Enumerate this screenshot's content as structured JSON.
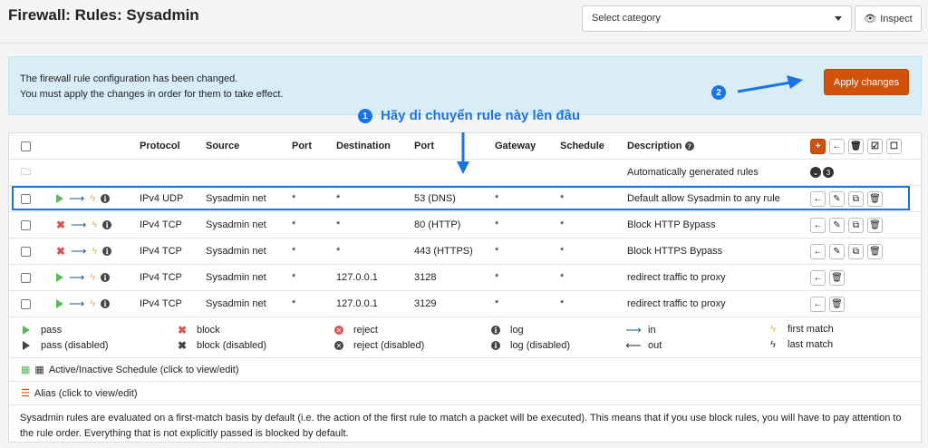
{
  "header": {
    "title": "Firewall: Rules: Sysadmin",
    "category_placeholder": "Select category",
    "inspect_label": "Inspect"
  },
  "alert": {
    "line1": "The firewall rule configuration has been changed.",
    "line2": "You must apply the changes in order for them to take effect.",
    "apply_label": "Apply changes"
  },
  "annotations": {
    "step1_number": "1",
    "step1_text": "Hãy di chuyển rule này lên đầu",
    "step2_number": "2",
    "color": "#1a73e8"
  },
  "table": {
    "columns": [
      "Protocol",
      "Source",
      "Port",
      "Destination",
      "Port",
      "Gateway",
      "Schedule",
      "Description"
    ],
    "auto_rules_label": "Automatically generated rules",
    "auto_rules_count": "3",
    "rows": [
      {
        "action": "pass",
        "protocol": "IPv4 UDP",
        "source": "Sysadmin net",
        "src_port": "*",
        "destination": "*",
        "dst_port": "53 (DNS)",
        "gateway": "*",
        "schedule": "*",
        "description": "Default allow Sysadmin to any rule",
        "highlighted": true,
        "buttons": [
          "move",
          "edit",
          "copy",
          "delete"
        ]
      },
      {
        "action": "block",
        "protocol": "IPv4 TCP",
        "source": "Sysadmin net",
        "src_port": "*",
        "destination": "*",
        "dst_port": "80 (HTTP)",
        "gateway": "*",
        "schedule": "*",
        "description": "Block HTTP Bypass",
        "highlighted": false,
        "buttons": [
          "move",
          "edit",
          "copy",
          "delete"
        ]
      },
      {
        "action": "block",
        "protocol": "IPv4 TCP",
        "source": "Sysadmin net",
        "src_port": "*",
        "destination": "*",
        "dst_port": "443 (HTTPS)",
        "gateway": "*",
        "schedule": "*",
        "description": "Block HTTPS Bypass",
        "highlighted": false,
        "buttons": [
          "move",
          "edit",
          "copy",
          "delete"
        ]
      },
      {
        "action": "pass",
        "protocol": "IPv4 TCP",
        "source": "Sysadmin net",
        "src_port": "*",
        "destination": "127.0.0.1",
        "dst_port": "3128",
        "gateway": "*",
        "schedule": "*",
        "description": "redirect traffic to proxy",
        "highlighted": false,
        "buttons": [
          "move",
          "delete"
        ]
      },
      {
        "action": "pass",
        "protocol": "IPv4 TCP",
        "source": "Sysadmin net",
        "src_port": "*",
        "destination": "127.0.0.1",
        "dst_port": "3129",
        "gateway": "*",
        "schedule": "*",
        "description": "redirect traffic to proxy",
        "highlighted": false,
        "buttons": [
          "move",
          "delete"
        ]
      }
    ]
  },
  "legend": {
    "pass": "pass",
    "pass_disabled": "pass (disabled)",
    "block": "block",
    "block_disabled": "block (disabled)",
    "reject": "reject",
    "reject_disabled": "reject (disabled)",
    "log": "log",
    "log_disabled": "log (disabled)",
    "in": "in",
    "out": "out",
    "first_match": "first match",
    "last_match": "last match"
  },
  "footer": {
    "schedule_label": "Active/Inactive Schedule (click to view/edit)",
    "alias_label": "Alias (click to view/edit)",
    "note": "Sysadmin rules are evaluated on a first-match basis by default (i.e. the action of the first rule to match a packet will be executed). This means that if you use block rules, you will have to pay attention to the rule order. Everything that is not explicitly passed is blocked by default."
  },
  "colors": {
    "accent": "#d3520a",
    "pass": "#5cb85c",
    "block": "#d9534f",
    "alert_bg": "#d9edf7"
  }
}
